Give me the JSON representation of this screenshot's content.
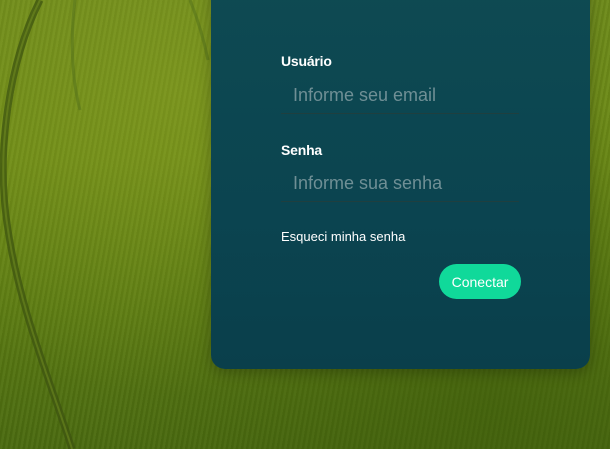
{
  "background": {
    "icon": "wheat-field-image"
  },
  "login": {
    "username_label": "Usuário",
    "username_placeholder": "Informe seu email",
    "password_label": "Senha",
    "password_placeholder": "Informe sua senha",
    "forgot_label": "Esqueci minha senha",
    "submit_label": "Conectar",
    "accent_color": "#10d99a",
    "panel_color": "#0b4450"
  }
}
